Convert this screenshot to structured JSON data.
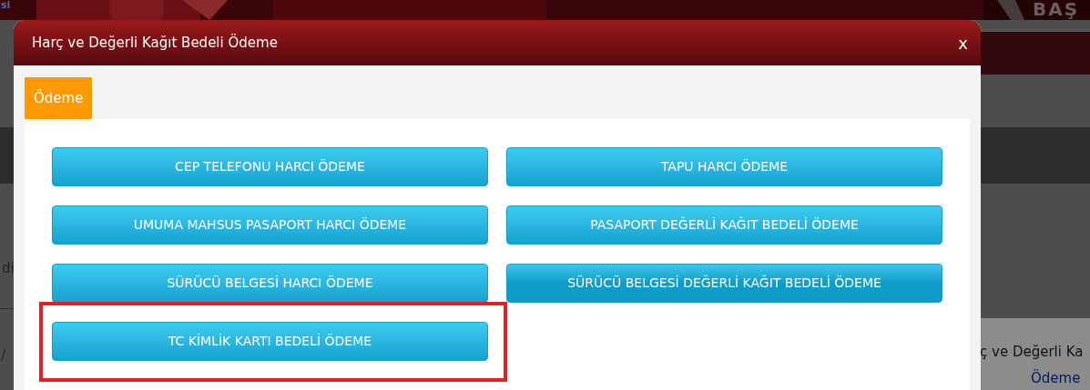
{
  "background": {
    "top_left_text": "si",
    "top_right_text": "BAŞ",
    "left_text_1": "di",
    "left_text_2": "/",
    "right_heading": "ç ve Değerli Ka",
    "right_link": "Ödeme"
  },
  "modal": {
    "title": "Harç ve Değerli Kağıt Bedeli Ödeme",
    "close": "x",
    "tabs": [
      {
        "label": "Ödeme",
        "selected": true
      }
    ],
    "buttons": [
      {
        "label": "CEP TELEFONU HARCI ÖDEME",
        "hovered": false
      },
      {
        "label": "TAPU HARCI ÖDEME",
        "hovered": false
      },
      {
        "label": "UMUMA MAHSUS PASAPORT HARCI ÖDEME",
        "hovered": false
      },
      {
        "label": "PASAPORT DEĞERLİ KAĞIT BEDELİ ÖDEME",
        "hovered": false
      },
      {
        "label": "SÜRÜCÜ BELGESİ HARCI ÖDEME",
        "hovered": false
      },
      {
        "label": "SÜRÜCÜ BELGESİ DEĞERLİ KAĞIT BEDELİ ÖDEME",
        "hovered": true
      },
      {
        "label": "TC KİMLİK KARTI BEDELİ ÖDEME",
        "hovered": false,
        "highlighted": true
      }
    ]
  }
}
